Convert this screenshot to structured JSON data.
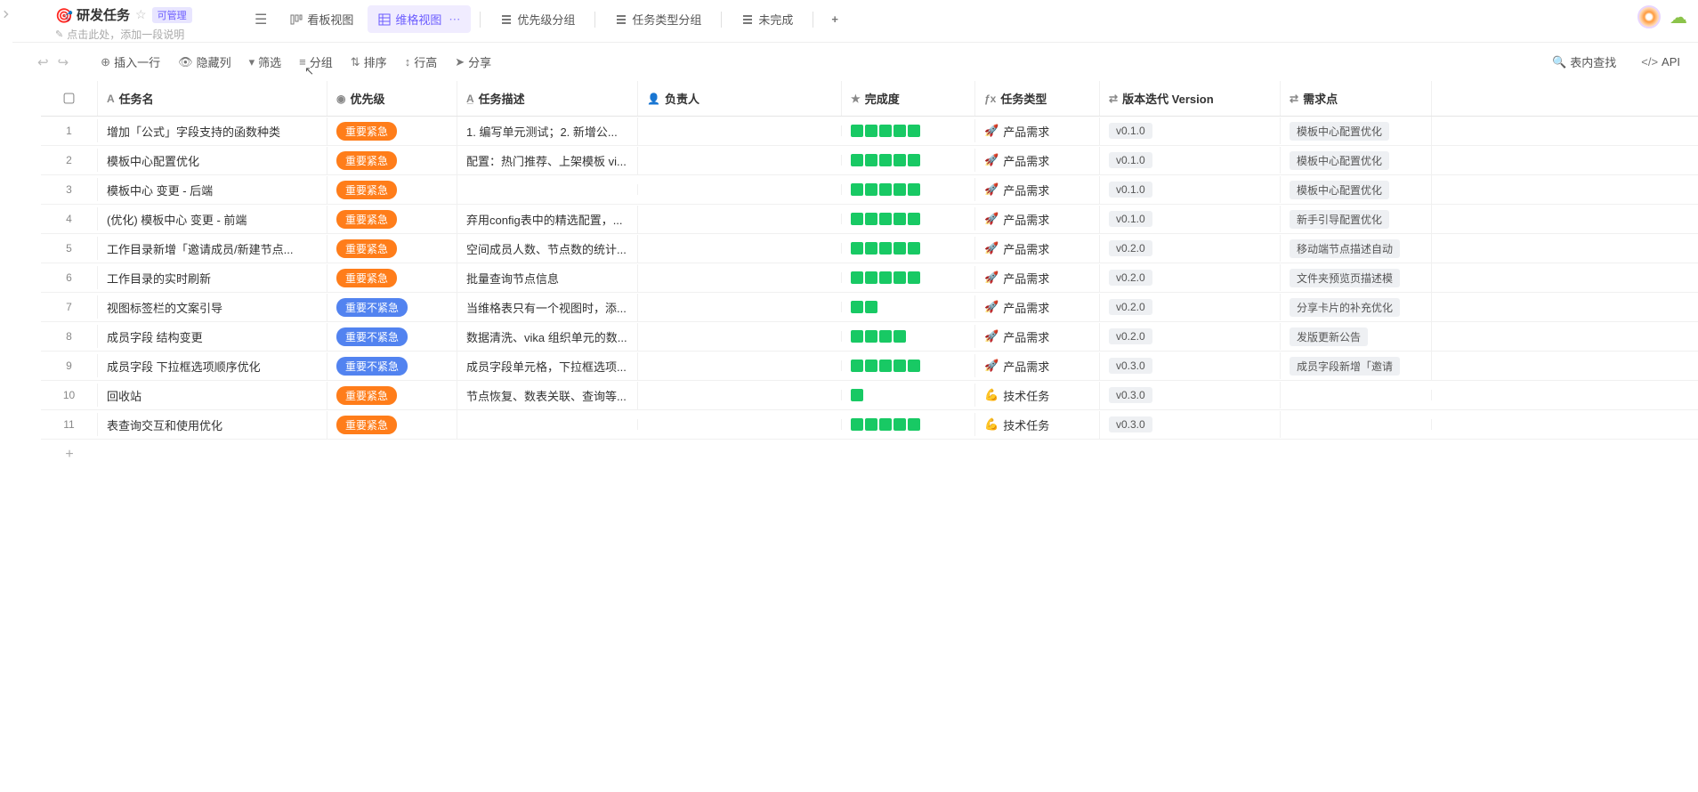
{
  "header": {
    "emoji": "🎯",
    "title": "研发任务",
    "badge": "可管理",
    "subtitle": "点击此处，添加一段说明"
  },
  "tabs": [
    {
      "id": "kanban",
      "label": "看板视图",
      "active": false
    },
    {
      "id": "grid",
      "label": "维格视图",
      "active": true
    },
    {
      "id": "prio",
      "label": "优先级分组",
      "active": false
    },
    {
      "id": "type",
      "label": "任务类型分组",
      "active": false
    },
    {
      "id": "undone",
      "label": "未完成",
      "active": false
    }
  ],
  "toolbar": {
    "insert": "插入一行",
    "hide": "隐藏列",
    "filter": "筛选",
    "group": "分组",
    "sort": "排序",
    "rowheight": "行高",
    "share": "分享",
    "search": "表内查找",
    "api": "API"
  },
  "columns": {
    "name": "任务名",
    "priority": "优先级",
    "desc": "任务描述",
    "owner": "负责人",
    "progress": "完成度",
    "type": "任务类型",
    "version": "版本迭代 Version",
    "req": "需求点"
  },
  "priority_labels": {
    "urgent": "重要紧急",
    "not_urgent": "重要不紧急"
  },
  "type_labels": {
    "product": "产品需求",
    "tech": "技术任务"
  },
  "rows": [
    {
      "idx": 1,
      "name": "增加「公式」字段支持的函数种类",
      "prio": "urgent",
      "desc": "1. 编写单元测试；2. 新增公...",
      "prog": 5,
      "type": "product",
      "ver": "v0.1.0",
      "req": "模板中心配置优化"
    },
    {
      "idx": 2,
      "name": "模板中心配置优化",
      "prio": "urgent",
      "desc": "配置：热门推荐、上架模板 vi...",
      "prog": 5,
      "type": "product",
      "ver": "v0.1.0",
      "req": "模板中心配置优化"
    },
    {
      "idx": 3,
      "name": "模板中心 变更 - 后端",
      "prio": "urgent",
      "desc": "",
      "prog": 5,
      "type": "product",
      "ver": "v0.1.0",
      "req": "模板中心配置优化"
    },
    {
      "idx": 4,
      "name": "(优化) 模板中心 变更 - 前端",
      "prio": "urgent",
      "desc": "弃用config表中的精选配置，...",
      "prog": 5,
      "type": "product",
      "ver": "v0.1.0",
      "req": "新手引导配置优化"
    },
    {
      "idx": 5,
      "name": "工作目录新增「邀请成员/新建节点...",
      "prio": "urgent",
      "desc": "空间成员人数、节点数的统计...",
      "prog": 5,
      "type": "product",
      "ver": "v0.2.0",
      "req": "移动端节点描述自动"
    },
    {
      "idx": 6,
      "name": "工作目录的实时刷新",
      "prio": "urgent",
      "desc": "批量查询节点信息",
      "prog": 5,
      "type": "product",
      "ver": "v0.2.0",
      "req": "文件夹预览页描述模"
    },
    {
      "idx": 7,
      "name": "视图标签栏的文案引导",
      "prio": "not_urgent",
      "desc": "当维格表只有一个视图时，添...",
      "prog": 2,
      "type": "product",
      "ver": "v0.2.0",
      "req": "分享卡片的补充优化"
    },
    {
      "idx": 8,
      "name": "成员字段 结构变更",
      "prio": "not_urgent",
      "desc": "数据清洗、vika 组织单元的数...",
      "prog": 4,
      "type": "product",
      "ver": "v0.2.0",
      "req": "发版更新公告"
    },
    {
      "idx": 9,
      "name": "成员字段 下拉框选项顺序优化",
      "prio": "not_urgent",
      "desc": "成员字段单元格，下拉框选项...",
      "prog": 5,
      "type": "product",
      "ver": "v0.3.0",
      "req": "成员字段新增「邀请"
    },
    {
      "idx": 10,
      "name": "回收站",
      "prio": "urgent",
      "desc": "节点恢复、数表关联、查询等...",
      "prog": 1,
      "type": "tech",
      "ver": "v0.3.0",
      "req": ""
    },
    {
      "idx": 11,
      "name": "表查询交互和使用优化",
      "prio": "urgent",
      "desc": "",
      "prog": 5,
      "type": "tech",
      "ver": "v0.3.0",
      "req": ""
    }
  ]
}
